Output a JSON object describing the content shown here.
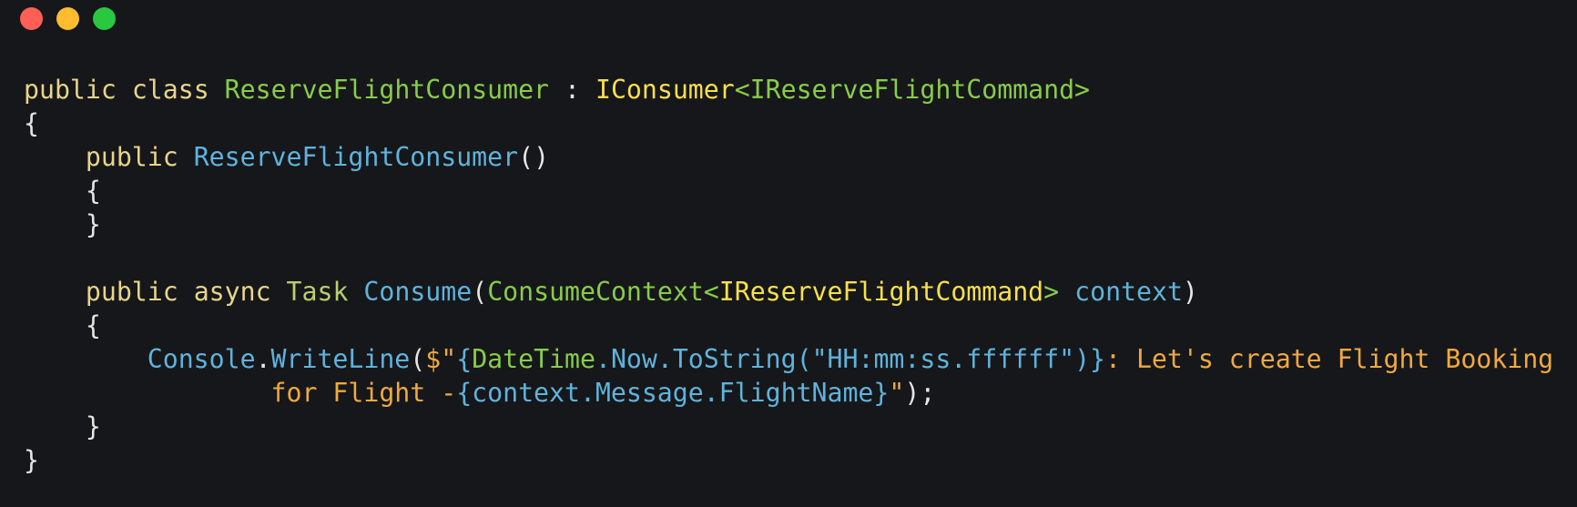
{
  "window": {
    "controls": {
      "close": "close-dot",
      "minimize": "minimize-dot",
      "maximize": "maximize-dot",
      "close_color": "#ff5f57",
      "minimize_color": "#febc2e",
      "maximize_color": "#28c840"
    }
  },
  "code": {
    "l1": {
      "a": "public",
      "b": " ",
      "c": "class",
      "d": " ",
      "e": "ReserveFlightConsumer",
      "f": " : ",
      "g": "IConsumer",
      "h": "<IReserveFlightCommand>"
    },
    "l2": {
      "a": "{"
    },
    "l3": {
      "indent": "    ",
      "a": "public",
      "b": " ",
      "c": "ReserveFlightConsumer",
      "d": "()"
    },
    "l4": {
      "indent": "    ",
      "a": "{"
    },
    "l5": {
      "indent": "    ",
      "a": "}"
    },
    "l6": {
      "a": ""
    },
    "l7": {
      "indent": "    ",
      "a": "public",
      "b": " ",
      "c": "async",
      "d": " ",
      "e": "Task",
      "f": " ",
      "g": "Consume",
      "h": "(",
      "i": "ConsumeContext<",
      "j": "IReserveFlightCommand",
      "k": ">",
      "l": " ",
      "m": "context",
      "n": ")"
    },
    "l8": {
      "indent": "    ",
      "a": "{"
    },
    "l9": {
      "indent": "        ",
      "a": "Console",
      "b": ".",
      "c": "WriteLine",
      "d": "(",
      "e": "$\"",
      "f": "{",
      "g": "DateTime",
      "h": ".Now.ToString(",
      "i": "\"HH:mm:ss.ffffff\"",
      "j": ")}",
      "k": ": Let's create Flight Booking"
    },
    "l10": {
      "indent": "                ",
      "a": "for Flight -",
      "b": "{context.Message.FlightName}",
      "c": "\"",
      "d": ");"
    },
    "l11": {
      "indent": "    ",
      "a": "}"
    },
    "l12": {
      "a": "}"
    }
  }
}
